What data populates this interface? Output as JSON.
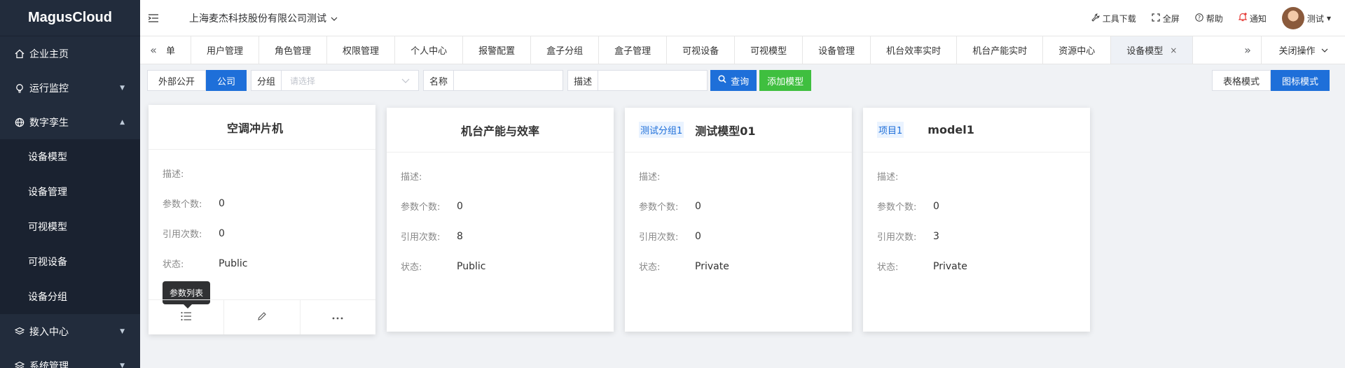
{
  "app": {
    "logo": "MagusCloud"
  },
  "sidebar": {
    "items": [
      {
        "label": "企业主页",
        "icon": "home-icon"
      },
      {
        "label": "运行监控",
        "icon": "bulb-icon"
      },
      {
        "label": "数字孪生",
        "icon": "globe-icon"
      },
      {
        "label": "接入中心",
        "icon": "layers-icon"
      },
      {
        "label": "系统管理",
        "icon": "layers-icon"
      }
    ],
    "submenu": [
      "设备模型",
      "设备管理",
      "可视模型",
      "可视设备",
      "设备分组"
    ]
  },
  "header": {
    "company": "上海麦杰科技股份有限公司测试",
    "tools": "工具下载",
    "fullscreen": "全屏",
    "help": "帮助",
    "notice": "通知",
    "user": "测试"
  },
  "tabs": {
    "items": [
      "菜单",
      "用户管理",
      "角色管理",
      "权限管理",
      "个人中心",
      "报警配置",
      "盒子分组",
      "盒子管理",
      "可视设备",
      "可视模型",
      "设备管理",
      "机台效率实时",
      "机台产能实时",
      "资源中心",
      "设备模型"
    ],
    "close_ops": "关闭操作"
  },
  "filters": {
    "scope_external": "外部公开",
    "scope_company": "公司",
    "group_label": "分组",
    "group_placeholder": "请选择",
    "name_label": "名称",
    "desc_label": "描述",
    "search": "查询",
    "add_model": "添加模型",
    "table_mode": "表格模式",
    "icon_mode": "图标模式"
  },
  "labels": {
    "desc": "描述:",
    "params": "参数个数:",
    "refs": "引用次数:",
    "status": "状态:"
  },
  "tooltip": "参数列表",
  "cards": [
    {
      "group": "",
      "title": "空调冲片机",
      "desc": "",
      "params": "0",
      "refs": "0",
      "status": "Public"
    },
    {
      "group": "",
      "title": "机台产能与效率",
      "desc": "",
      "params": "0",
      "refs": "8",
      "status": "Public"
    },
    {
      "group": "测试分组1",
      "title": "测试模型01",
      "desc": "",
      "params": "0",
      "refs": "0",
      "status": "Private"
    },
    {
      "group": "项目1",
      "title": "model1",
      "desc": "",
      "params": "0",
      "refs": "3",
      "status": "Private"
    }
  ]
}
